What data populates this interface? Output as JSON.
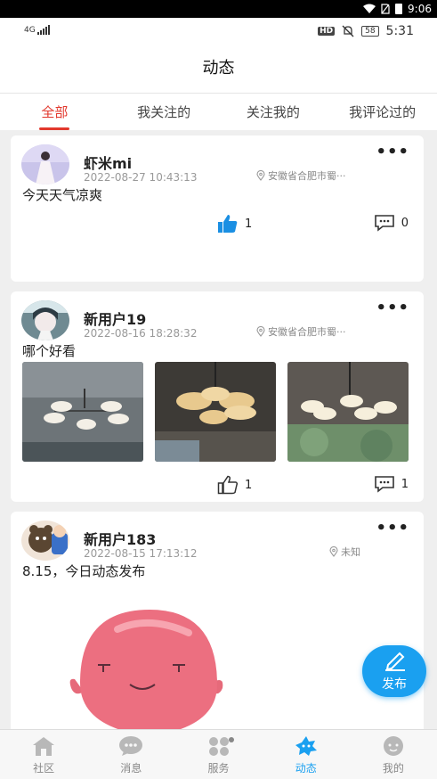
{
  "system_bar": {
    "time": "9:06"
  },
  "status_row": {
    "network": "4G",
    "battery": "58",
    "time": "5:31",
    "hd": "HD"
  },
  "header": {
    "title": "动态"
  },
  "tabs": [
    {
      "label": "全部",
      "active": true
    },
    {
      "label": "我关注的",
      "active": false
    },
    {
      "label": "关注我的",
      "active": false
    },
    {
      "label": "我评论过的",
      "active": false
    }
  ],
  "posts": [
    {
      "username": "虾米mi",
      "time": "2022-08-27 10:43:13",
      "location": "安徽省合肥市蜀···",
      "text": "今天天气凉爽",
      "likes": "1",
      "comments": "0",
      "liked": true
    },
    {
      "username": "新用户19",
      "time": "2022-08-16 18:28:32",
      "location": "安徽省合肥市蜀···",
      "text": "哪个好看",
      "likes": "1",
      "comments": "1",
      "liked": false
    },
    {
      "username": "新用户183",
      "time": "2022-08-15 17:13:12",
      "location": "未知",
      "text": "8.15，今日动态发布"
    }
  ],
  "fab": {
    "label": "发布"
  },
  "bottom_nav": [
    {
      "label": "社区",
      "icon": "home-icon",
      "active": false
    },
    {
      "label": "消息",
      "icon": "chat-icon",
      "active": false
    },
    {
      "label": "服务",
      "icon": "grid-icon",
      "active": false
    },
    {
      "label": "动态",
      "icon": "moments-icon",
      "active": true
    },
    {
      "label": "我的",
      "icon": "profile-icon",
      "active": false
    }
  ],
  "colors": {
    "accent": "#e2382d",
    "brand_blue": "#1aa0f0"
  }
}
